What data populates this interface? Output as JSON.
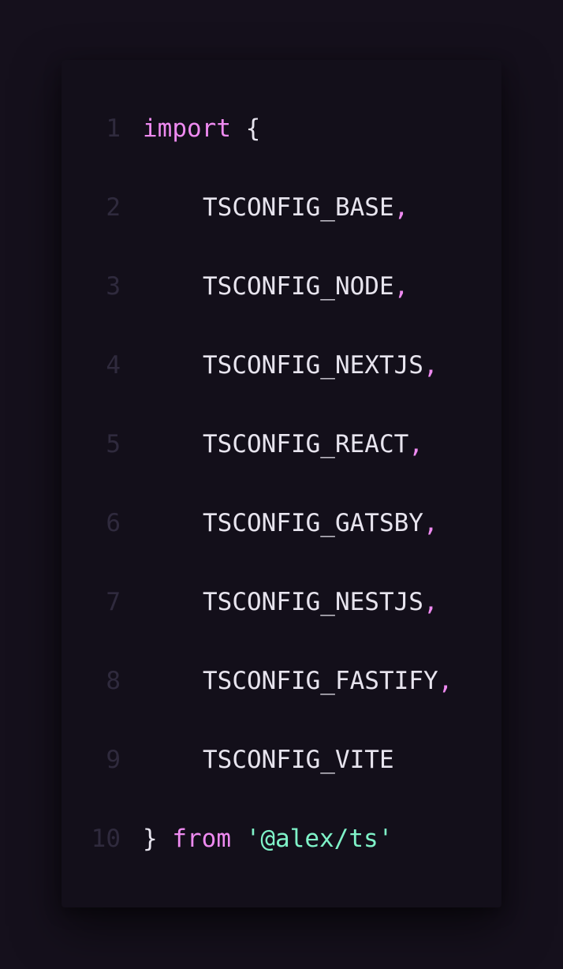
{
  "colors": {
    "background": "#15101c",
    "panel": "#130f1a",
    "keyword": "#ee8af0",
    "identifier": "#e7e4ee",
    "string": "#7ff2c8",
    "line_number": "#2f2a3d"
  },
  "lines": [
    {
      "number": "1",
      "keyword": "import",
      "brace": "{"
    },
    {
      "number": "2",
      "identifier": "TSCONFIG_BASE",
      "comma": ","
    },
    {
      "number": "3",
      "identifier": "TSCONFIG_NODE",
      "comma": ","
    },
    {
      "number": "4",
      "identifier": "TSCONFIG_NEXTJS",
      "comma": ","
    },
    {
      "number": "5",
      "identifier": "TSCONFIG_REACT",
      "comma": ","
    },
    {
      "number": "6",
      "identifier": "TSCONFIG_GATSBY",
      "comma": ","
    },
    {
      "number": "7",
      "identifier": "TSCONFIG_NESTJS",
      "comma": ","
    },
    {
      "number": "8",
      "identifier": "TSCONFIG_FASTIFY",
      "comma": ","
    },
    {
      "number": "9",
      "identifier": "TSCONFIG_VITE"
    },
    {
      "number": "10",
      "brace": "}",
      "keyword": "from",
      "string": "'@alex/ts'"
    }
  ]
}
